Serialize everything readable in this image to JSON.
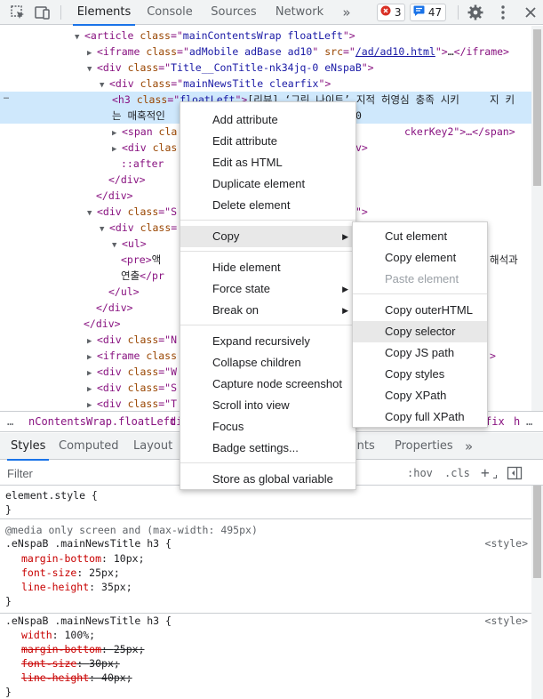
{
  "toolbar": {
    "tabs": [
      "Elements",
      "Console",
      "Sources",
      "Network"
    ],
    "more": "»",
    "errors": "3",
    "messages": "47",
    "icons": [
      "inspect-icon",
      "device-toggle-icon",
      "gear-icon",
      "kebab-menu-icon",
      "close-icon"
    ]
  },
  "tree": {
    "rows": [
      {
        "arrow": "▼",
        "parts": [
          [
            "tag",
            "<article "
          ],
          [
            "an",
            "class"
          ],
          [
            "tag",
            "=\""
          ],
          [
            "av",
            "mainContentsWrap floatLeft"
          ],
          [
            "tag",
            "\">"
          ]
        ]
      },
      {
        "arrow": "▶",
        "parts": [
          [
            "tag",
            "<iframe "
          ],
          [
            "an",
            "class"
          ],
          [
            "tag",
            "=\""
          ],
          [
            "av",
            "adMobile adBase ad10"
          ],
          [
            "tag",
            "\" "
          ],
          [
            "an",
            "src"
          ],
          [
            "tag",
            "=\""
          ],
          [
            "lnk",
            "/ad/ad10.html"
          ],
          [
            "tag",
            "\">"
          ],
          [
            "txt",
            "…"
          ],
          [
            "tag",
            "</iframe>"
          ]
        ]
      },
      {
        "arrow": "▼",
        "parts": [
          [
            "tag",
            "<div "
          ],
          [
            "an",
            "class"
          ],
          [
            "tag",
            "=\""
          ],
          [
            "av",
            "Title__ConTitle-nk34jq-0 eNspaB"
          ],
          [
            "tag",
            "\">"
          ]
        ]
      },
      {
        "arrow": "▼",
        "parts": [
          [
            "tag",
            "<div "
          ],
          [
            "an",
            "class"
          ],
          [
            "tag",
            "=\""
          ],
          [
            "av",
            "mainNewsTitle clearfix"
          ],
          [
            "tag",
            "\">"
          ]
        ]
      },
      {
        "arrow": "",
        "parts": [
          [
            "tag",
            "<h3 "
          ],
          [
            "an",
            "class"
          ],
          [
            "tag",
            "=\""
          ],
          [
            "av",
            "floatLeft"
          ],
          [
            "tag",
            "\">"
          ],
          [
            "txt",
            "[리뷰] ‘그린 나이트’ 지적 허영심 충족 시키"
          ]
        ]
      },
      {
        "arrow": "",
        "parts": [
          [
            "txt",
            "는 매혹적인"
          ]
        ]
      },
      {
        "arrow": "▶",
        "parts": [
          [
            "tag",
            "<span "
          ],
          [
            "an",
            "cla"
          ]
        ]
      },
      {
        "arrow": "▶",
        "parts": [
          [
            "tag",
            "<div "
          ],
          [
            "an",
            "clas"
          ]
        ]
      },
      {
        "arrow": "",
        "parts": [
          [
            "pseudo",
            "::after"
          ]
        ]
      },
      {
        "arrow": "",
        "parts": [
          [
            "tag",
            "</div>"
          ]
        ]
      },
      {
        "arrow": "",
        "parts": [
          [
            "tag",
            "</div>"
          ]
        ]
      },
      {
        "arrow": "▼",
        "parts": [
          [
            "tag",
            "<div "
          ],
          [
            "an",
            "class"
          ],
          [
            "tag",
            "=\"S"
          ]
        ]
      },
      {
        "arrow": "▼",
        "parts": [
          [
            "tag",
            "<div "
          ],
          [
            "an",
            "class"
          ],
          [
            "tag",
            "="
          ]
        ]
      },
      {
        "arrow": "▼",
        "parts": [
          [
            "tag",
            "<ul>"
          ]
        ]
      },
      {
        "arrow": "",
        "parts": [
          [
            "tag",
            "<pre>"
          ],
          [
            "txt",
            "액"
          ]
        ]
      },
      {
        "arrow": "",
        "parts": [
          [
            "txt",
            "연출"
          ],
          [
            "tag",
            "</pr"
          ]
        ]
      },
      {
        "arrow": "",
        "parts": [
          [
            "tag",
            "</ul>"
          ]
        ]
      },
      {
        "arrow": "",
        "parts": [
          [
            "tag",
            "</div>"
          ]
        ]
      },
      {
        "arrow": "",
        "parts": [
          [
            "tag",
            "</div>"
          ]
        ]
      },
      {
        "arrow": "▶",
        "parts": [
          [
            "tag",
            "<div "
          ],
          [
            "an",
            "class"
          ],
          [
            "tag",
            "=\"N"
          ]
        ]
      },
      {
        "arrow": "▶",
        "parts": [
          [
            "tag",
            "<iframe "
          ],
          [
            "an",
            "class"
          ]
        ]
      },
      {
        "arrow": "▶",
        "parts": [
          [
            "tag",
            "<div "
          ],
          [
            "an",
            "class"
          ],
          [
            "tag",
            "=\"W"
          ]
        ]
      },
      {
        "arrow": "▶",
        "parts": [
          [
            "tag",
            "<div "
          ],
          [
            "an",
            "class"
          ],
          [
            "tag",
            "=\"S"
          ]
        ]
      },
      {
        "arrow": "▶",
        "parts": [
          [
            "tag",
            "<div "
          ],
          [
            "an",
            "class"
          ],
          [
            "tag",
            "=\"T"
          ]
        ]
      }
    ],
    "peek_right": [
      {
        "row": 4,
        "text": "지 키"
      },
      {
        "row": 5,
        "text": "0"
      },
      {
        "row": 6,
        "text": "ckerKey2\">…</span>"
      },
      {
        "row": 7,
        "text": "v>"
      },
      {
        "row": 11,
        "text": "\">"
      },
      {
        "row": 14,
        "text": "해석과"
      },
      {
        "row": 20,
        "text": ">"
      }
    ],
    "ellipsis": "…"
  },
  "breadcrumb": {
    "more": "…",
    "items": [
      "nContentsWrap.floatLeft",
      "di",
      "fix",
      "h"
    ],
    "more_end": "…"
  },
  "styles_tabs": {
    "tabs": [
      "Styles",
      "Computed",
      "Layout",
      "ints",
      "Properties"
    ],
    "more": "»"
  },
  "filter": {
    "placeholder": "Filter",
    "hov": ":hov",
    "cls": ".cls",
    "plus": "+"
  },
  "styles": {
    "element_style": "element.style {",
    "close": "}",
    "media": "@media only screen and (max-width: 495px)",
    "rule1_selector": ".eNspaB .mainNewsTitle h3 {",
    "rule1_source": "<style>",
    "rule1_props": [
      {
        "name": "margin-bottom",
        "value": "10px;"
      },
      {
        "name": "font-size",
        "value": "25px;"
      },
      {
        "name": "line-height",
        "value": "35px;"
      }
    ],
    "rule2_selector": ".eNspaB .mainNewsTitle h3 {",
    "rule2_source": "<style>",
    "rule2_props": [
      {
        "name": "width",
        "value": "100%;",
        "struck": false
      },
      {
        "name": "margin-bottom",
        "value": "25px;",
        "struck": true
      },
      {
        "name": "font-size",
        "value": "30px;",
        "struck": true
      },
      {
        "name": "line-height",
        "value": "40px;",
        "struck": true
      }
    ]
  },
  "context_menu": {
    "items": [
      "Add attribute",
      "Edit attribute",
      "Edit as HTML",
      "Duplicate element",
      "Delete element",
      "Copy",
      "Hide element",
      "Force state",
      "Break on",
      "Expand recursively",
      "Collapse children",
      "Capture node screenshot",
      "Scroll into view",
      "Focus",
      "Badge settings...",
      "Store as global variable"
    ],
    "highlighted": "Copy"
  },
  "copy_submenu": {
    "items": [
      "Cut element",
      "Copy element",
      "Paste element",
      "Copy outerHTML",
      "Copy selector",
      "Copy JS path",
      "Copy styles",
      "Copy XPath",
      "Copy full XPath"
    ],
    "disabled": "Paste element",
    "highlighted": "Copy selector"
  },
  "colors": {
    "accent": "#1a73e8",
    "selection": "#cfe8fc",
    "tag": "#881280",
    "attr_name": "#994500",
    "attr_value": "#1a1aa6",
    "prop_name": "#c80000"
  }
}
